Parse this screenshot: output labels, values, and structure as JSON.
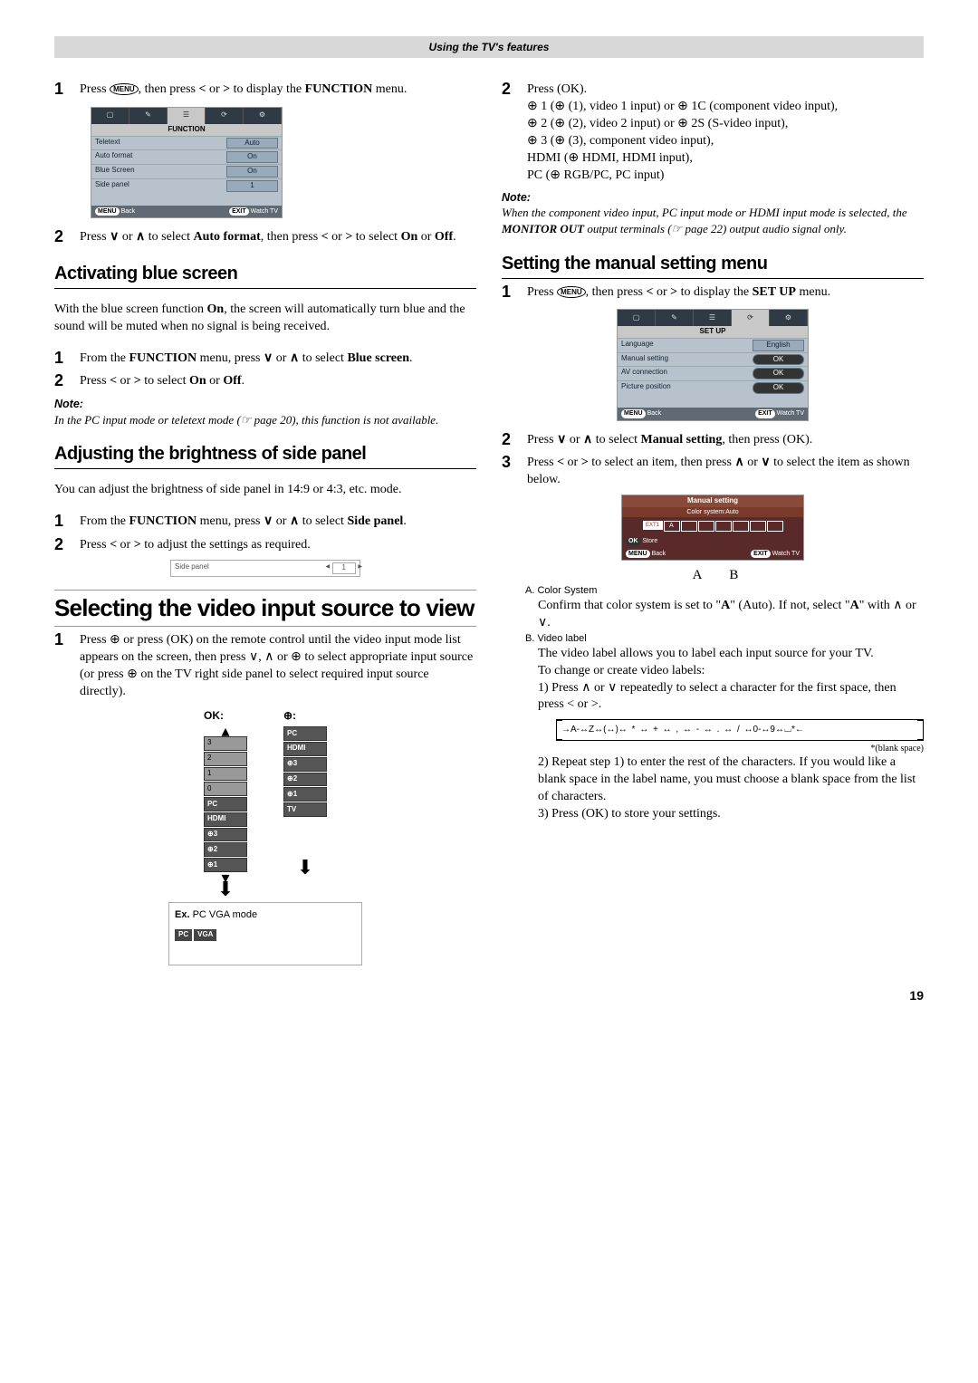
{
  "header": "Using the TV's features",
  "left": {
    "step1a": {
      "num": "1",
      "pre": "Press ",
      "icon": "MENU",
      "mid": ", then press ",
      "k1": "<",
      "or": " or ",
      "k2": ">",
      "post": " to display the ",
      "bold": "FUNCTION",
      "tail": " menu."
    },
    "osd1": {
      "title": "FUNCTION",
      "rows": [
        {
          "l": "Teletext",
          "r": "Auto"
        },
        {
          "l": "Auto format",
          "r": "On"
        },
        {
          "l": "Blue Screen",
          "r": "On"
        },
        {
          "l": "Side panel",
          "r": "1"
        }
      ],
      "foot_l_btn": "MENU",
      "foot_l": "Back",
      "foot_r_btn": "EXIT",
      "foot_r": "Watch TV"
    },
    "step2a": {
      "num": "2",
      "pre": "Press ",
      "k1": "∨",
      "or1": " or ",
      "k2": "∧",
      "mid": " to select ",
      "bold": "Auto format",
      "mid2": ", then press ",
      "k3": "<",
      "or2": " or ",
      "k4": ">",
      "post": " to select ",
      "b1": "On",
      "or3": " or ",
      "b2": "Off",
      "dot": "."
    },
    "h_blue": "Activating blue screen",
    "blue_para": {
      "p1": "With the blue screen function ",
      "b": "On",
      "p2": ", the screen will automatically turn blue and the sound will be muted when no signal is being received."
    },
    "blue_s1": {
      "num": "1",
      "pre": "From the ",
      "b1": "FUNCTION",
      "mid": " menu, press ",
      "k1": "∨",
      "or": " or ",
      "k2": "∧",
      "post": " to select ",
      "b2": "Blue screen",
      "dot": "."
    },
    "blue_s2": {
      "num": "2",
      "pre": "Press ",
      "k1": "<",
      "or": " or ",
      "k2": ">",
      "mid": " to select ",
      "b1": "On",
      "or2": " or ",
      "b2": "Off",
      "dot": "."
    },
    "note1_l": "Note:",
    "note1_b": "In the PC input mode or teletext mode (☞ page 20), this function is not available.",
    "h_side": "Adjusting the brightness of side panel",
    "side_p": "You can adjust the brightness of side panel in 14:9 or 4:3, etc. mode.",
    "side_s1": {
      "num": "1",
      "pre": "From the ",
      "b1": "FUNCTION",
      "mid": " menu, press ",
      "k1": "∨",
      "or": " or ",
      "k2": "∧",
      "post": " to select ",
      "b2": "Side panel",
      "dot": "."
    },
    "side_s2": {
      "num": "2",
      "pre": "Press ",
      "k1": "<",
      "or": " or ",
      "k2": ">",
      "post": " to adjust the settings as required."
    },
    "osd_slim": {
      "label": "Side panel",
      "val": "1"
    },
    "h_video": "Selecting the video input source to view",
    "vid_s1": {
      "num": "1",
      "text": "Press ⊕ or press (OK) on the remote control until the video input mode list appears on the screen, then press ∨, ∧ or ⊕ to select appropriate input source (or press ⊕ on the TV right side panel to select required input source directly)."
    },
    "stacks": {
      "h1": "OK:",
      "h2": "⊕:",
      "list1": [
        "3",
        "2",
        "1",
        "0",
        "PC",
        "HDMI",
        "⊕3",
        "⊕2",
        "⊕1"
      ],
      "list2": [
        "PC",
        "HDMI",
        "⊕3",
        "⊕2",
        "⊕1",
        "TV"
      ]
    },
    "ex_label": "Ex.",
    "ex_text": "PC VGA mode",
    "ex_tags": [
      "PC",
      "VGA"
    ]
  },
  "right": {
    "step2b": {
      "num": "2",
      "text": "Press (OK)."
    },
    "lines": [
      "⊕ 1 (⊕ (1), video 1 input) or ⊕ 1C (component video input),",
      "⊕ 2 (⊕ (2), video 2 input) or ⊕ 2S (S-video input),",
      "⊕ 3 (⊕ (3), component video input),",
      "HDMI (⊕ HDMI, HDMI input),",
      "PC (⊕ RGB/PC, PC input)"
    ],
    "note2_l": "Note:",
    "note2_b": {
      "p1": "When the component video input, PC input mode or HDMI input mode is selected, the ",
      "b": "MONITOR OUT",
      "p2": " output terminals (☞ page 22) output audio signal only."
    },
    "h_manual": "Setting the manual setting menu",
    "man_s1": {
      "num": "1",
      "pre": "Press ",
      "icon": "MENU",
      "mid": ", then press ",
      "k1": "<",
      "or": " or ",
      "k2": ">",
      "post": " to display the ",
      "bold": "SET UP",
      "tail": " menu."
    },
    "osd2": {
      "title": "SET UP",
      "rows": [
        {
          "l": "Language",
          "r": "English"
        },
        {
          "l": "Manual setting",
          "r": "OK"
        },
        {
          "l": "AV connection",
          "r": "OK"
        },
        {
          "l": "Picture position",
          "r": "OK"
        }
      ],
      "foot_l_btn": "MENU",
      "foot_l": "Back",
      "foot_r_btn": "EXIT",
      "foot_r": "Watch TV"
    },
    "man_s2": {
      "num": "2",
      "pre": "Press ",
      "k1": "∨",
      "or": " or ",
      "k2": "∧",
      "mid": " to select ",
      "b": "Manual setting",
      "post": ", then press (OK)."
    },
    "man_s3": {
      "num": "3",
      "pre": "Press ",
      "k1": "<",
      "or": " or ",
      "k2": ">",
      "mid": " to select an item, then press ",
      "k3": "∧",
      "or2": " or ",
      "k4": "∨",
      "post": " to select the item as shown below."
    },
    "osd3": {
      "title": "Manual setting",
      "sub": "Color system:Auto",
      "tag": "EXT1",
      "boxA": "A",
      "store": "Store",
      "foot_l_btn": "MENU",
      "foot_l": "Back",
      "foot_r_btn": "EXIT",
      "foot_r": "Watch TV"
    },
    "ab_A": "A",
    "ab_B": "B",
    "itemA_h": "A. Color System",
    "itemA_b": {
      "p1": "Confirm that color system is set to \"",
      "b1": "A",
      "p2": "\" (Auto). If not, select \"",
      "b2": "A",
      "p3": "\" with ∧ or ∨."
    },
    "itemB_h": "B. Video label",
    "itemB_p1": "The video label allows you to label each input source for your TV.",
    "itemB_p2": "To change or create video labels:",
    "itemB_1": "1) Press ∧ or ∨ repeatedly to select a character for the first space, then press < or >.",
    "charlist": "→A-↔Z↔(↔)↔ * ↔ + ↔ , ↔ - ↔ . ↔ / ↔0-↔9↔⌴*←",
    "blank": "*(blank space)",
    "itemB_2": "2) Repeat step 1) to enter the rest of the characters. If you would like a blank space in the label name, you must choose a blank space from the list of characters.",
    "itemB_3": "3) Press (OK) to store your settings."
  },
  "page": "19"
}
